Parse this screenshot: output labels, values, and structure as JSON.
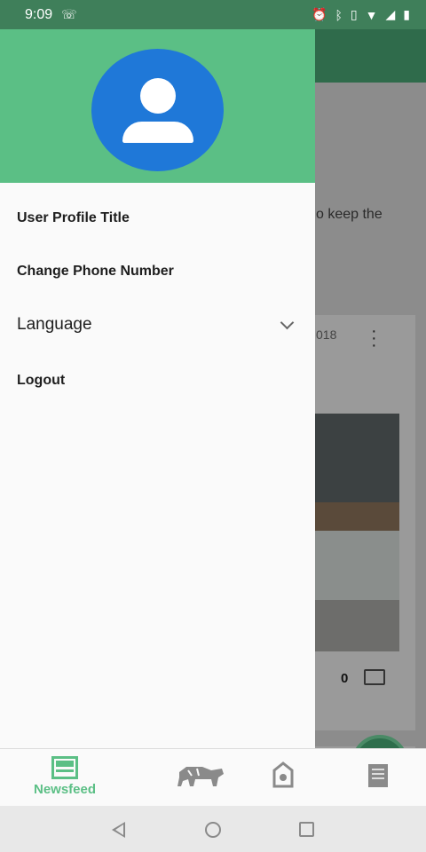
{
  "status_bar": {
    "time": "9:09",
    "call_icon": "wifi-call-icon",
    "right_icons": [
      "alarm-icon",
      "bluetooth-icon",
      "vibrate-icon",
      "wifi-icon",
      "signal-icon",
      "battery-icon"
    ]
  },
  "background": {
    "snippet": "o keep the",
    "post_date_partial": "018",
    "post_date_partial_2": "018",
    "comment_count": "0"
  },
  "drawer": {
    "items": [
      {
        "label": "User Profile Title"
      },
      {
        "label": "Change Phone Number"
      },
      {
        "label": "Language"
      },
      {
        "label": "Logout"
      }
    ]
  },
  "bottom_nav": {
    "items": [
      {
        "label": "Newsfeed",
        "icon": "newsfeed-icon",
        "active": true
      },
      {
        "label": "",
        "icon": "livestock-icon"
      },
      {
        "label": "",
        "icon": "tag-icon"
      },
      {
        "label": "",
        "icon": "document-icon"
      }
    ]
  },
  "colors": {
    "accent": "#5bbf85",
    "avatar": "#1f78d8"
  }
}
